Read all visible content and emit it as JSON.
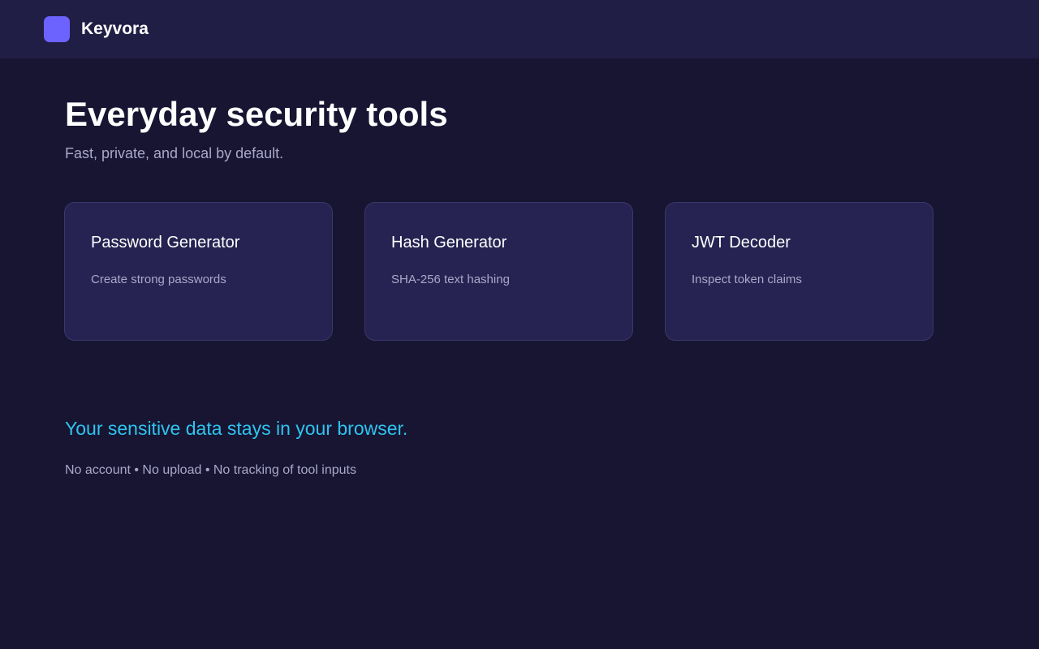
{
  "header": {
    "logo_icon": "square-logo-icon",
    "brand_name": "Keyvora",
    "accent_color": "#6c63ff",
    "background_color": "#211e45"
  },
  "hero": {
    "title": "Everyday security tools",
    "subtitle": "Fast, private, and local by default."
  },
  "tools": [
    {
      "title": "Password Generator",
      "description": "Create strong passwords"
    },
    {
      "title": "Hash Generator",
      "description": "SHA-256 text hashing"
    },
    {
      "title": "JWT Decoder",
      "description": "Inspect token claims"
    }
  ],
  "privacy": {
    "headline": "Your sensitive data stays in your browser.",
    "note": "No account • No upload • No tracking of tool inputs",
    "headline_color": "#2ec4ef"
  },
  "page_background_color": "#171532"
}
